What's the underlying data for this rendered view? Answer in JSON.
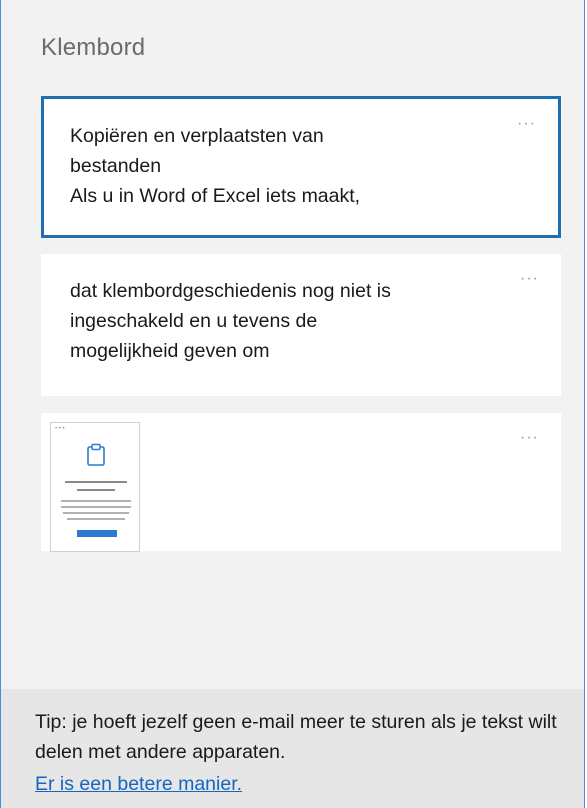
{
  "panel": {
    "title": "Klembord"
  },
  "items": [
    {
      "text_lines": [
        "Kopiëren en verplaatsten van",
        "bestanden",
        "Als u in Word of Excel iets maakt,"
      ],
      "more_label": "···",
      "selected": true
    },
    {
      "text_lines": [
        "dat klembordgeschiedenis nog niet is",
        "ingeschakeld en u tevens de",
        "mogelijkheid geven om"
      ],
      "more_label": "···",
      "selected": false
    },
    {
      "type": "image",
      "more_label": "···",
      "selected": false
    }
  ],
  "tip": {
    "text": "Tip: je hoeft jezelf geen e-mail meer te sturen als je tekst wilt delen met andere apparaten.",
    "link": "Er is een betere manier."
  },
  "colors": {
    "selected_border": "#1f6fb3",
    "link": "#1566c0",
    "panel_bg": "#f2f2f2",
    "tip_bg": "#e6e6e6"
  },
  "icons": {
    "more": "more-options-icon",
    "thumbnail_clipboard": "clipboard-icon"
  }
}
